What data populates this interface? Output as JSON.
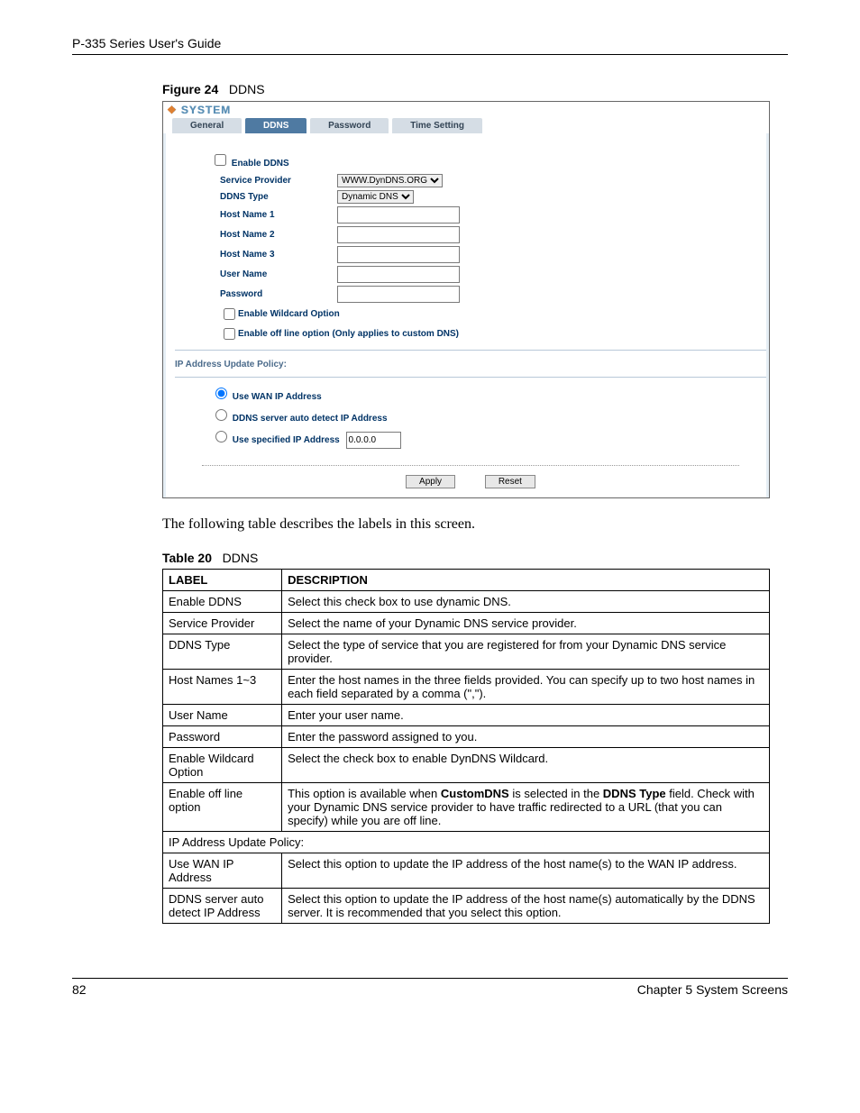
{
  "header": {
    "guide": "P-335 Series User's Guide"
  },
  "figure": {
    "num": "Figure 24",
    "title": "DDNS"
  },
  "ui": {
    "system": "SYSTEM",
    "tabs": {
      "general": "General",
      "ddns": "DDNS",
      "password": "Password",
      "timesetting": "Time Setting"
    },
    "fields": {
      "enable_ddns": "Enable DDNS",
      "service_provider": "Service Provider",
      "sp_option": "WWW.DynDNS.ORG",
      "ddns_type": "DDNS Type",
      "dt_option": "Dynamic DNS",
      "host1": "Host Name 1",
      "host2": "Host Name 2",
      "host3": "Host Name 3",
      "user": "User Name",
      "pass": "Password",
      "wildcard": "Enable Wildcard Option",
      "offline": "Enable off line option (Only applies to custom DNS)"
    },
    "policy": {
      "section": "IP Address Update Policy:",
      "wan": "Use WAN IP Address",
      "auto": "DDNS server auto detect IP Address",
      "spec": "Use specified IP Address",
      "spec_val": "0.0.0.0"
    },
    "btns": {
      "apply": "Apply",
      "reset": "Reset"
    }
  },
  "body_text": "The following table describes the labels in this screen.",
  "table": {
    "num": "Table 20",
    "title": "DDNS",
    "header": {
      "label": "LABEL",
      "desc": "DESCRIPTION"
    },
    "rows": [
      {
        "l": "Enable DDNS",
        "d": "Select this check box to use dynamic DNS."
      },
      {
        "l": "Service Provider",
        "d": "Select the name of your Dynamic DNS service provider."
      },
      {
        "l": "DDNS Type",
        "d": "Select the type of service that you are registered for from your Dynamic DNS service provider."
      },
      {
        "l": "Host Names 1~3",
        "d": "Enter the host names in the three fields provided. You can specify up to two host names in each field separated by a comma (\",\")."
      },
      {
        "l": "User Name",
        "d": "Enter your user name."
      },
      {
        "l": "Password",
        "d": "Enter the password assigned to you."
      },
      {
        "l": "Enable Wildcard Option",
        "d": "Select the check box to enable DynDNS Wildcard."
      },
      {
        "l": "Enable off line option",
        "d_html": "This option is available when <b>CustomDNS</b> is selected in the <b>DDNS Type</b> field. Check with your Dynamic DNS service provider to have traffic redirected to a URL (that you can specify) while you are off line."
      },
      {
        "l": "IP Address Update Policy:",
        "span": true
      },
      {
        "l": "Use WAN IP Address",
        "d": "Select this option to update the IP address of the host name(s) to the WAN IP address."
      },
      {
        "l": "DDNS server auto detect IP Address",
        "d": "Select this option to update the IP address of the host name(s) automatically by the DDNS server. It is recommended that you select this option."
      }
    ]
  },
  "footer": {
    "page": "82",
    "chapter": "Chapter 5 System Screens"
  }
}
